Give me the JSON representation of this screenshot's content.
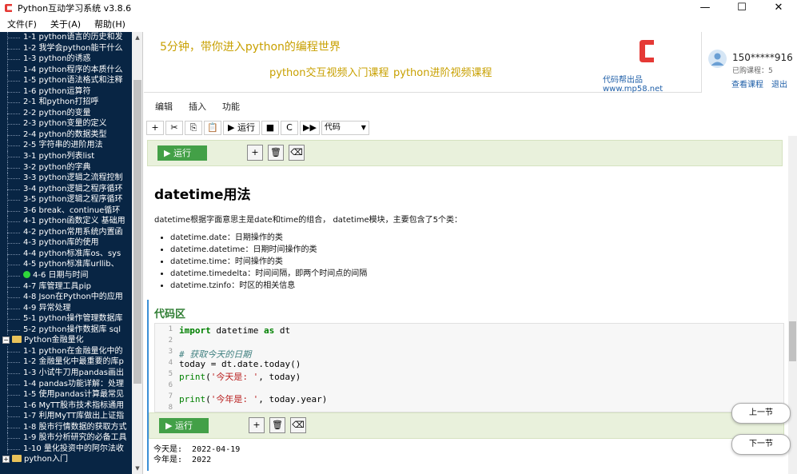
{
  "app": {
    "title": "Python互动学习系统 v3.8.6",
    "menu": [
      "文件(F)",
      "关于(A)",
      "帮助(H)"
    ]
  },
  "tree": {
    "items": [
      {
        "label": "1-1 python语言的历史和发",
        "type": "child"
      },
      {
        "label": "1-2 我学会python能干什么",
        "type": "child"
      },
      {
        "label": "1-3 python的诱惑",
        "type": "child"
      },
      {
        "label": "1-4 python程序的本质什么",
        "type": "child"
      },
      {
        "label": "1-5 python语法格式和注释",
        "type": "child"
      },
      {
        "label": "1-6 python运算符",
        "type": "child"
      },
      {
        "label": "2-1 和python打招呼",
        "type": "child"
      },
      {
        "label": "2-2 python的变量",
        "type": "child"
      },
      {
        "label": "2-3 python变量的定义",
        "type": "child"
      },
      {
        "label": "2-4 python的数据类型",
        "type": "child"
      },
      {
        "label": "2-5 字符串的进阶用法",
        "type": "child"
      },
      {
        "label": "3-1 python列表list",
        "type": "child"
      },
      {
        "label": "3-2 python的字典",
        "type": "child"
      },
      {
        "label": "3-3 python逻辑之流程控制",
        "type": "child"
      },
      {
        "label": "3-4 python逻辑之程序循环",
        "type": "child"
      },
      {
        "label": "3-5 python逻辑之程序循环",
        "type": "child"
      },
      {
        "label": "3-6 break、continue循环",
        "type": "child"
      },
      {
        "label": "4-1 python函数定义 基础用",
        "type": "child"
      },
      {
        "label": "4-2 python常用系统内置函",
        "type": "child"
      },
      {
        "label": "4-3 python库的使用",
        "type": "child"
      },
      {
        "label": "4-4 python标准库os、sys",
        "type": "child"
      },
      {
        "label": "4-5 python标准库urllib、",
        "type": "child"
      },
      {
        "label": "4-6 日期与时间",
        "type": "child",
        "current": true
      },
      {
        "label": "4-7 库管理工具pip",
        "type": "child"
      },
      {
        "label": "4-8 Json在Python中的应用",
        "type": "child"
      },
      {
        "label": "4-9 异常处理",
        "type": "child"
      },
      {
        "label": "5-1 python操作管理数据库",
        "type": "child"
      },
      {
        "label": "5-2 python操作数据库 sql",
        "type": "child"
      },
      {
        "label": "Python金融量化",
        "type": "group",
        "expander": "−"
      },
      {
        "label": "1-1 python在金融量化中的",
        "type": "child"
      },
      {
        "label": "1-2 金融量化中最重要的库p",
        "type": "child"
      },
      {
        "label": "1-3 小试牛刀用pandas画出",
        "type": "child"
      },
      {
        "label": "1-4 pandas功能详解：处理",
        "type": "child"
      },
      {
        "label": "1-5 使用pandas计算最常见",
        "type": "child"
      },
      {
        "label": "1-6 MyTT股市技术指标通用",
        "type": "child"
      },
      {
        "label": "1-7 利用MyTT库做出上证指",
        "type": "child"
      },
      {
        "label": "1-8 股市行情数据的获取方式",
        "type": "child"
      },
      {
        "label": "1-9 股市分析研究的必备工具",
        "type": "child"
      },
      {
        "label": "1-10 量化投资中的阿尔法收",
        "type": "child"
      },
      {
        "label": "python入门",
        "type": "group",
        "expander": "+"
      }
    ]
  },
  "banner": {
    "slogan": "5分钟，带你进入python的编程世界",
    "link1": "python交互视频入门课程",
    "link2": "python进阶视频课程",
    "brand": "代码帮出品 www.mp58.net"
  },
  "user": {
    "phone": "150*****916",
    "owned": "已购课程：5",
    "view": "查看课程",
    "logout": "退出"
  },
  "notebook_menu": [
    "编辑",
    "插入",
    "功能"
  ],
  "toolbar": {
    "buttons": [
      "+",
      "✂",
      "⎘",
      "📋",
      "▶ 运行",
      "■",
      "C",
      "▶▶"
    ],
    "cell_type": "代码"
  },
  "cell_run_label": "▶ 运行",
  "markdown": {
    "heading": "datetime用法",
    "intro": "datetime根据字面意思主是date和time的组合， datetime模块，主要包含了5个类：",
    "items": [
      "datetime.date：日期操作的类",
      "datetime.datetime：日期时间操作的类",
      "datetime.time：时间操作的类",
      "datetime.timedelta：时间间隔，即两个时间点的间隔",
      "datetime.tzinfo：时区的相关信息"
    ]
  },
  "code_cell": {
    "heading": "代码区",
    "line_numbers": [
      "1",
      "2",
      "3",
      "4",
      "5",
      "6",
      "7",
      "8"
    ],
    "output": [
      "今天是:  2022-04-19",
      "今年是:  2022"
    ]
  },
  "nav": {
    "prev": "上一节",
    "next": "下一节"
  },
  "colors": {
    "sidebar_bg": "#082544",
    "run_button": "#43a047",
    "cell_bar": "#e9f1dc",
    "accent_text": "#c8a000",
    "link": "#1f5fa8"
  }
}
